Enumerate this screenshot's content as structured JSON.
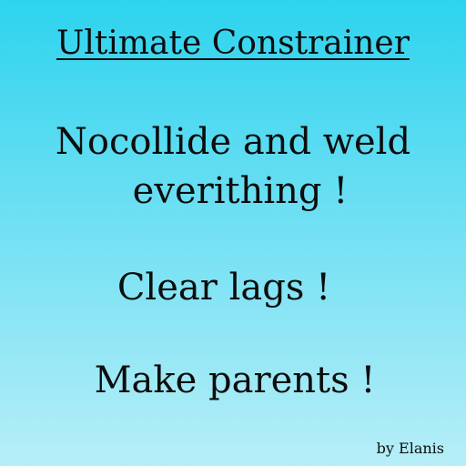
{
  "title": "Ultimate Constrainer",
  "lines": [
    "Nocollide and weld",
    "everithing !",
    "Clear lags !",
    "Make parents !"
  ],
  "credit": "by Elanis",
  "colors": {
    "background_top": "#2dd3ee",
    "background_bottom": "#b7eef8",
    "text": "#0d0d0d"
  }
}
